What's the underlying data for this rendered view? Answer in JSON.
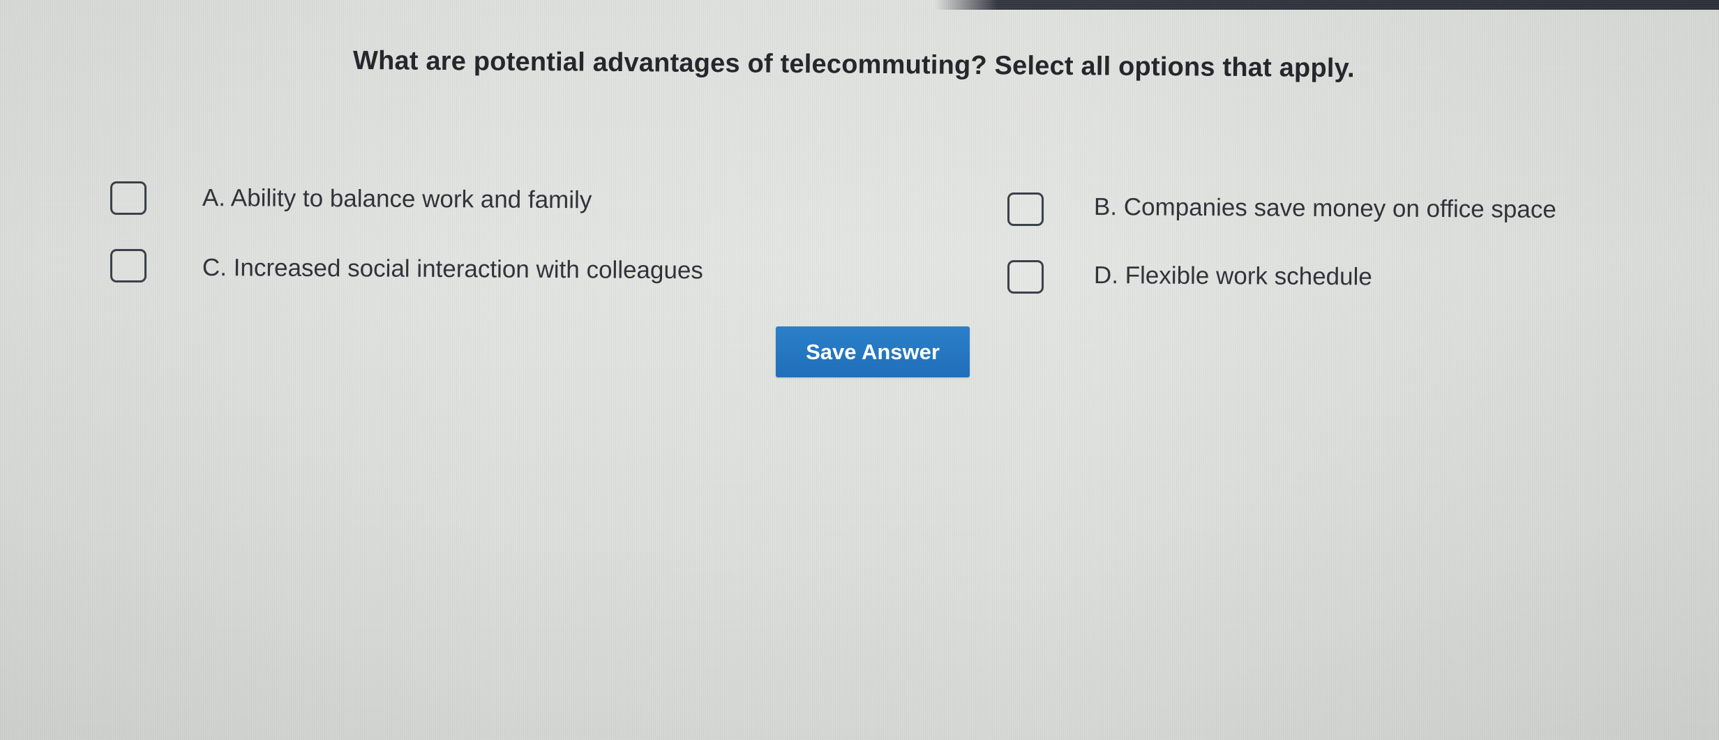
{
  "question": {
    "text": "What are potential advantages of telecommuting? Select all options that apply."
  },
  "options": [
    {
      "id": "A",
      "label": "A. Ability to balance work and family",
      "checked": false
    },
    {
      "id": "B",
      "label": "B. Companies save money on office space",
      "checked": false
    },
    {
      "id": "C",
      "label": "C. Increased social interaction with colleagues",
      "checked": false
    },
    {
      "id": "D",
      "label": "D. Flexible work schedule",
      "checked": false
    }
  ],
  "actions": {
    "save_label": "Save Answer"
  },
  "colors": {
    "button_background": "#1f6fba",
    "button_text": "#ffffff",
    "text": "#2c2f33"
  }
}
